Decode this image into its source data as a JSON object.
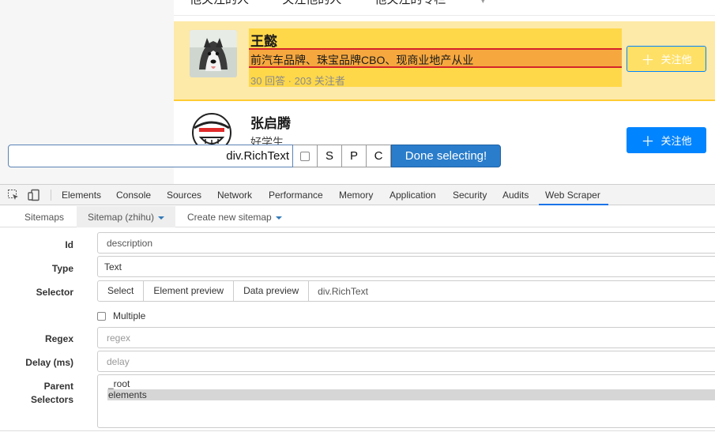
{
  "page": {
    "top_tabs": [
      "他关注的人",
      "关注他的人",
      "他关注的专栏"
    ],
    "users": [
      {
        "name": "王懿",
        "description": "前汽车品牌、珠宝品牌CBO、现商业地产从业",
        "stats": "30 回答 · 203 关注者",
        "follow_label": "关注他"
      },
      {
        "name": "张启腾",
        "description": "好学生",
        "follow_label": "关注他"
      }
    ]
  },
  "selector_bar": {
    "value": "div.RichText",
    "s_label": "S",
    "p_label": "P",
    "c_label": "C",
    "done_label": "Done selecting!"
  },
  "devtools": {
    "tabs": [
      "Elements",
      "Console",
      "Sources",
      "Network",
      "Performance",
      "Memory",
      "Application",
      "Security",
      "Audits",
      "Web Scraper"
    ],
    "active_tab": "Web Scraper"
  },
  "scraper_nav": {
    "sitemaps": "Sitemaps",
    "current": "Sitemap (zhihu)",
    "create": "Create new sitemap"
  },
  "form": {
    "id_label": "Id",
    "id_value": "description",
    "type_label": "Type",
    "type_value": "Text",
    "selector_label": "Selector",
    "select_btn": "Select",
    "element_preview_btn": "Element preview",
    "data_preview_btn": "Data preview",
    "selector_value": "div.RichText",
    "multiple_label": "Multiple",
    "regex_label": "Regex",
    "regex_placeholder": "regex",
    "delay_label": "Delay (ms)",
    "delay_placeholder": "delay",
    "parent_label_1": "Parent",
    "parent_label_2": "Selectors",
    "parent_options": [
      "_root",
      "elements"
    ],
    "parent_selected": "elements"
  }
}
